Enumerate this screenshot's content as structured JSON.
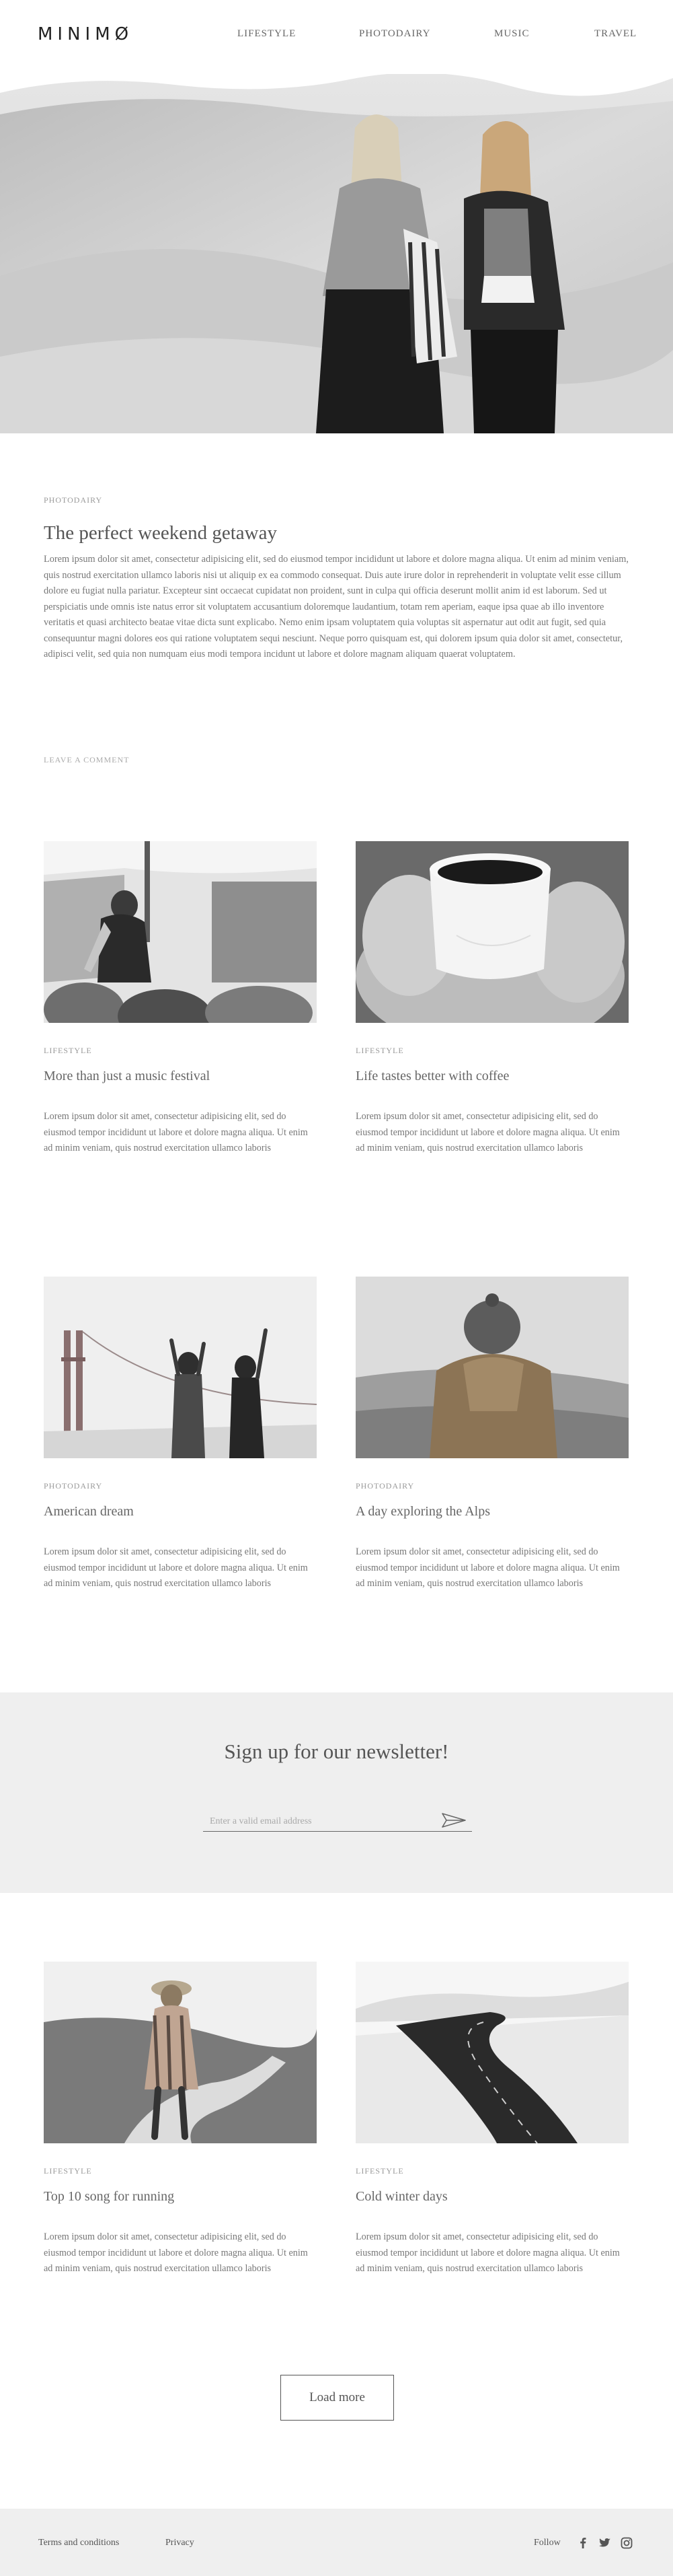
{
  "header": {
    "logo": "MINIMØ",
    "nav": [
      "LIFESTYLE",
      "PHOTODAIRY",
      "MUSIC",
      "TRAVEL"
    ]
  },
  "article": {
    "category": "PHOTODAIRY",
    "title": "The perfect weekend getaway",
    "body": "Lorem ipsum dolor sit amet, consectetur adipisicing elit, sed do eiusmod tempor incididunt ut labore et dolore magna aliqua. Ut enim ad minim veniam, quis nostrud exercitation ullamco laboris nisi ut aliquip ex ea commodo consequat. Duis aute irure dolor in reprehenderit in voluptate velit esse cillum dolore eu fugiat nulla pariatur. Excepteur sint occaecat cupidatat non proident, sunt in culpa qui officia deserunt mollit anim id est laborum. Sed ut perspiciatis unde omnis iste natus error sit voluptatem accusantium doloremque laudantium, totam rem aperiam, eaque ipsa quae ab illo inventore veritatis et quasi architecto beatae vitae dicta sunt explicabo. Nemo enim ipsam voluptatem quia voluptas sit aspernatur aut odit aut fugit, sed quia consequuntur magni dolores eos qui ratione voluptatem sequi nesciunt. Neque porro quisquam est, qui dolorem ipsum quia dolor sit amet, consectetur, adipisci velit, sed quia non numquam eius modi tempora incidunt ut labore et dolore magnam aliquam quaerat voluptatem.",
    "leave_comment": "LEAVE A COMMENT"
  },
  "cards": [
    {
      "category": "LIFESTYLE",
      "title": "More than just a music festival",
      "excerpt": "Lorem ipsum dolor sit amet, consectetur adipisicing elit, sed do eiusmod tempor incididunt ut labore et dolore magna aliqua. Ut enim ad minim veniam, quis nostrud exercitation ullamco laboris"
    },
    {
      "category": "LIFESTYLE",
      "title": "Life tastes better with coffee",
      "excerpt": "Lorem ipsum dolor sit amet, consectetur adipisicing elit, sed do eiusmod tempor incididunt ut labore et dolore magna aliqua. Ut enim ad minim veniam, quis nostrud exercitation ullamco laboris"
    },
    {
      "category": "PHOTODAIRY",
      "title": "American dream",
      "excerpt": "Lorem ipsum dolor sit amet, consectetur adipisicing elit, sed do eiusmod tempor incididunt ut labore et dolore magna aliqua. Ut enim ad minim veniam, quis nostrud exercitation ullamco laboris"
    },
    {
      "category": "PHOTODAIRY",
      "title": "A day exploring the Alps",
      "excerpt": "Lorem ipsum dolor sit amet, consectetur adipisicing elit, sed do eiusmod tempor incididunt ut labore et dolore magna aliqua. Ut enim ad minim veniam, quis nostrud exercitation ullamco laboris"
    },
    {
      "category": "LIFESTYLE",
      "title": "Top 10 song for running",
      "excerpt": "Lorem ipsum dolor sit amet, consectetur adipisicing elit, sed do eiusmod tempor incididunt ut labore et dolore magna aliqua. Ut enim ad minim veniam, quis nostrud exercitation ullamco laboris"
    },
    {
      "category": "LIFESTYLE",
      "title": "Cold winter days",
      "excerpt": "Lorem ipsum dolor sit amet, consectetur adipisicing elit, sed do eiusmod tempor incididunt ut labore et dolore magna aliqua. Ut enim ad minim veniam, quis nostrud exercitation ullamco laboris"
    }
  ],
  "newsletter": {
    "title": "Sign up for our newsletter!",
    "placeholder": "Enter a valid email address",
    "send_icon": "paper-plane-icon"
  },
  "load_more": "Load more",
  "footer": {
    "terms": "Terms and conditions",
    "privacy": "Privacy",
    "follow": "Follow",
    "social_icons": [
      "facebook-icon",
      "twitter-icon",
      "instagram-icon"
    ]
  },
  "colors": {
    "text": "#555555",
    "muted": "#9a9a9a",
    "panel": "#efefef"
  }
}
